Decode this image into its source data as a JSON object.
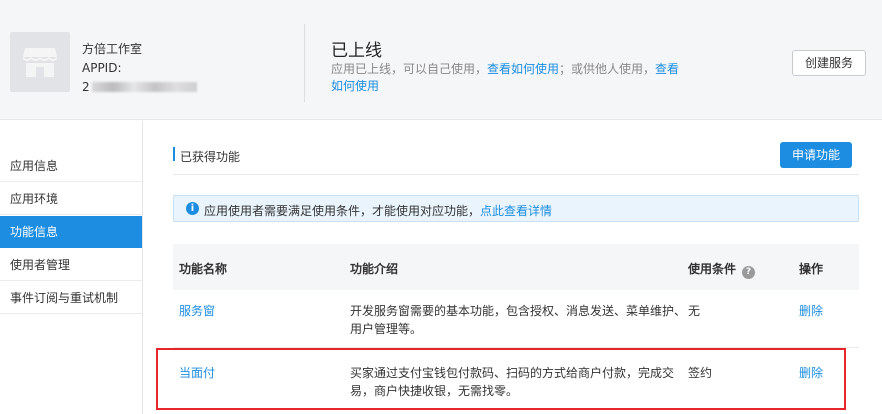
{
  "header": {
    "app_name": "方倍工作室",
    "appid_label": "APPID:",
    "appid_visible": "2",
    "status_title": "已上线",
    "status_desc_prefix": "应用已上线，可以自己使用，",
    "link_self": "查看如何使用",
    "status_desc_middle": "；或供他人使用，",
    "link_others": "查看如何使用",
    "create_button": "创建服务"
  },
  "sidebar": {
    "items": [
      {
        "label": "应用信息",
        "active": false
      },
      {
        "label": "应用环境",
        "active": false
      },
      {
        "label": "功能信息",
        "active": true
      },
      {
        "label": "使用者管理",
        "active": false
      },
      {
        "label": "事件订阅与重试机制",
        "active": false
      }
    ]
  },
  "main": {
    "section_title": "已获得功能",
    "apply_button": "申请功能",
    "notice_text": "应用使用者需要满足使用条件，才能使用对应功能，",
    "notice_link": "点此查看详情",
    "table": {
      "headers": [
        "功能名称",
        "功能介绍",
        "使用条件",
        "操作"
      ],
      "rows": [
        {
          "name": "服务窗",
          "desc": "开发服务窗需要的基本功能，包含授权、消息发送、菜单维护、用户管理等。",
          "cond": "无",
          "op": "删除"
        },
        {
          "name": "当面付",
          "desc": "买家通过支付宝钱包付款码、扫码的方式给商户付款，完成交易，商户快捷收银，无需找零。",
          "cond": "签约",
          "op": "删除"
        }
      ]
    }
  },
  "colors": {
    "accent": "#1c8de0",
    "highlight": "#e7262b"
  }
}
